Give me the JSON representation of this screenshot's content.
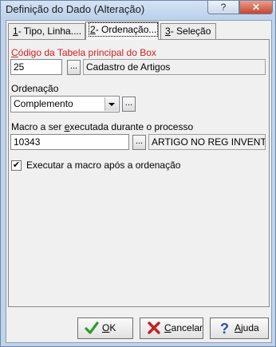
{
  "window": {
    "title": "Definição do Dado (Alteração)",
    "help_label": "?",
    "close_label": "✕"
  },
  "tabs": [
    {
      "num": "1",
      "label": "- Tipo, Linha...."
    },
    {
      "num": "2",
      "label": "- Ordenação..."
    },
    {
      "num": "3",
      "label": "- Seleção"
    }
  ],
  "box_table": {
    "label_u": "C",
    "label_rest": "ódigo da Tabela principal do Box",
    "code": "25",
    "lookup_label": "...",
    "name": "Cadastro de Artigos"
  },
  "ordering": {
    "label": "Ordenação",
    "selected": "Complemento",
    "lookup_label": "..."
  },
  "macro": {
    "label_pre": "Macro a ser ",
    "label_u": "e",
    "label_post": "xecutada durante o processo",
    "code": "10343",
    "lookup_label": "...",
    "name": "ARTIGO NO REG INVENTARIO"
  },
  "execute_after": {
    "checked": true,
    "check_glyph": "✔",
    "label": "Executar a macro após a ordenação"
  },
  "buttons": {
    "ok_u": "O",
    "ok_rest": "K",
    "cancel_u": "C",
    "cancel_rest": "ancelar",
    "help_u": "A",
    "help_rest": "juda"
  },
  "colors": {
    "required_label": "#d22020",
    "ok_icon": "#2e9b2e",
    "cancel_icon": "#c62020",
    "help_icon": "#2a4fb0"
  }
}
